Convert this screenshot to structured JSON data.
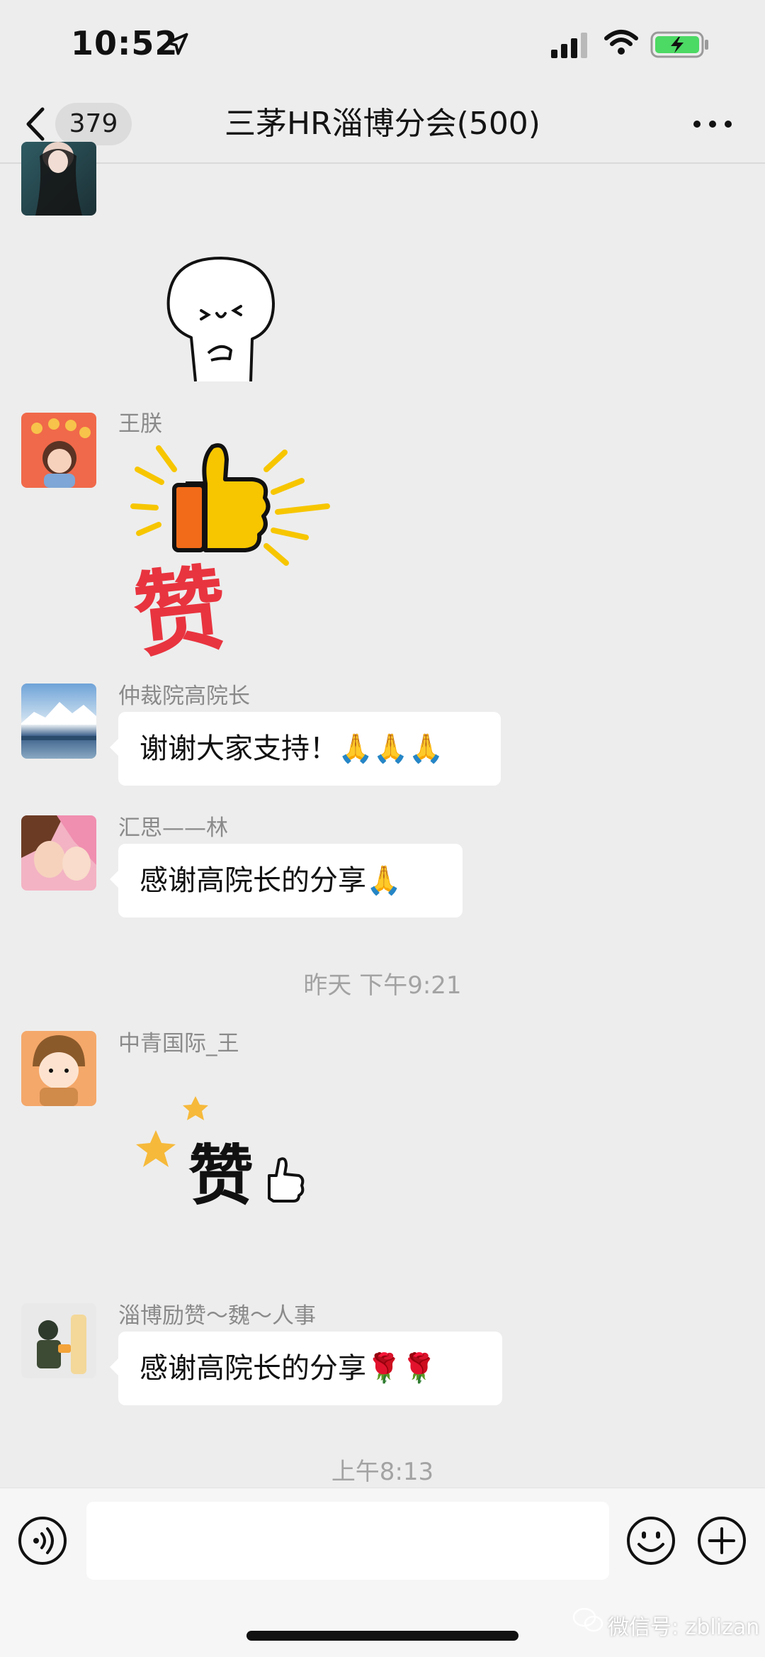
{
  "status_bar": {
    "time": "10:52",
    "icons": [
      "location-arrow-icon",
      "cellular-signal-icon",
      "wifi-icon",
      "battery-charging-icon"
    ]
  },
  "header": {
    "unread_count": "379",
    "title": "三茅HR淄博分会(500)",
    "icons": [
      "back-chevron-icon",
      "more-dots-icon"
    ]
  },
  "messages": [
    {
      "type": "sticker",
      "sticker": "cartoon-blob-sticker"
    },
    {
      "type": "sticker",
      "sender": "王朕",
      "sticker": "thumbs-up-zan-sticker",
      "sticker_text": "赞"
    },
    {
      "type": "text",
      "sender": "仲裁院高院长",
      "text": "谢谢大家支持！🙏🙏🙏"
    },
    {
      "type": "text",
      "sender": "汇思——林",
      "text": "感谢高院长的分享🙏"
    },
    {
      "type": "time",
      "text": "昨天 下午9:21"
    },
    {
      "type": "sticker",
      "sender": "中青国际_王",
      "sticker": "stars-zan-sticker",
      "sticker_text": "赞"
    },
    {
      "type": "text",
      "sender": "淄博励赞～魏～人事",
      "text": "感谢高院长的分享🌹🌹"
    },
    {
      "type": "time",
      "text": "上午8:13"
    }
  ],
  "input_bar": {
    "input_value": "",
    "icons": [
      "voice-icon",
      "emoji-icon",
      "plus-icon"
    ]
  },
  "watermark": "微信号: zblizan",
  "colors": {
    "background": "#ededed",
    "bubble": "#ffffff",
    "battery_green": "#4cd964",
    "zan_red": "#e8343f",
    "thumb_yellow": "#f7c600"
  }
}
